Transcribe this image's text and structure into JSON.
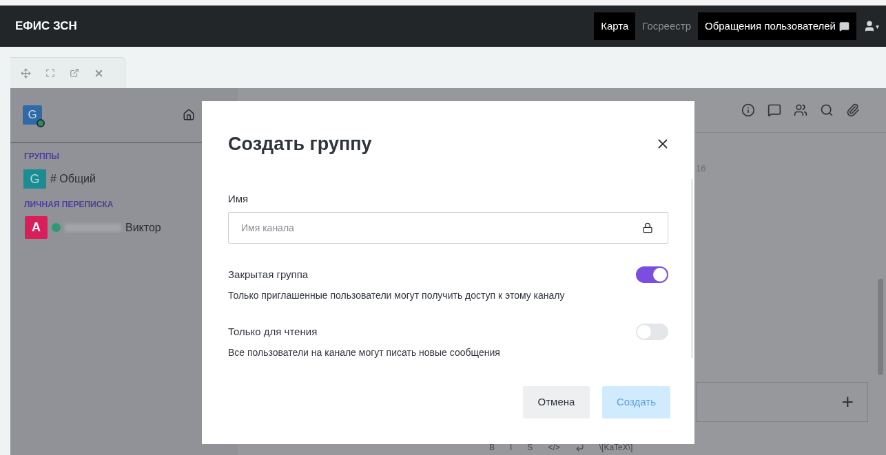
{
  "navbar": {
    "brand": "ЕФИС ЗСН",
    "links": [
      {
        "label": "Карта",
        "selected": true
      },
      {
        "label": "Госреестр",
        "selected": false
      },
      {
        "label": "Обращения пользователей",
        "selected": true
      }
    ],
    "user_menu_caret": "▾"
  },
  "sidebar": {
    "workspace_avatar": "G",
    "workspace_online": true,
    "groups_heading": "ГРУППЫ",
    "groups": [
      {
        "avatar": "G",
        "prefix": "#",
        "name": "Общий",
        "color": "#1a8d94"
      }
    ],
    "direct_heading": "ЛИЧНАЯ ПЕРЕПИСКА",
    "direct": [
      {
        "avatar": "A",
        "name": "Виктор",
        "online": true,
        "color": "#d81f5c"
      }
    ]
  },
  "chat": {
    "partial_text": "16",
    "composer_add": "+",
    "format_bar": [
      "B",
      "I",
      "S",
      "</>",
      "\\[KaTeX\\]"
    ]
  },
  "dialog": {
    "title": "Создать группу",
    "name_label": "Имя",
    "name_placeholder": "Имя канала",
    "toggles": [
      {
        "label": "Закрытая группа",
        "description": "Только приглашенные пользователи могут получить доступ к этому каналу",
        "on": true
      },
      {
        "label": "Только для чтения",
        "description": "Все пользователи на канале могут писать новые сообщения",
        "on": false
      }
    ],
    "cancel": "Отмена",
    "create": {
      "label": "Создать",
      "disabled": true
    }
  }
}
